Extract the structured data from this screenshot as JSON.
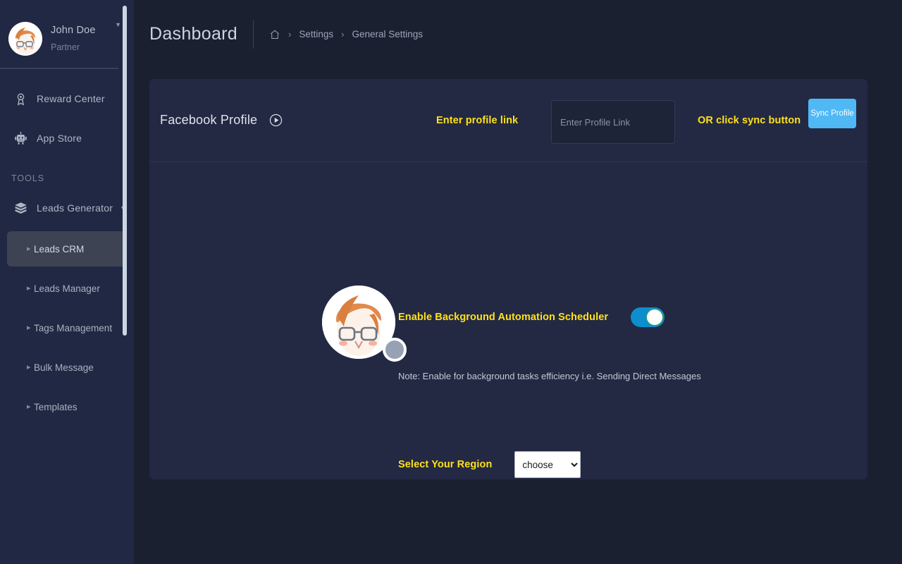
{
  "sidebar": {
    "user": {
      "name": "John Doe",
      "role": "Partner",
      "caret": "chevron-down-icon",
      "avatar_alt": "user-avatar"
    },
    "nav_items": [
      {
        "label": "Reward Center",
        "icon": "award-medal-icon"
      },
      {
        "label": "App Store",
        "icon": "robot-icon"
      }
    ],
    "section_label": "TOOLS",
    "group": {
      "label": "Leads Generator",
      "icon": "layers-stack-icon",
      "caret": "chevron-down-icon"
    },
    "submenu": [
      {
        "label": "Leads CRM",
        "active": true
      },
      {
        "label": "Leads Manager",
        "active": false
      },
      {
        "label": "Tags Management",
        "active": false
      },
      {
        "label": "Bulk Message",
        "active": false
      },
      {
        "label": "Templates",
        "active": false
      }
    ]
  },
  "header": {
    "title": "Dashboard",
    "breadcrumb": {
      "home_icon": "home-icon",
      "items": [
        "Settings",
        "General Settings"
      ],
      "separator": "›"
    }
  },
  "card": {
    "title": "Facebook Profile",
    "title_icon": "play-circle-icon",
    "enter_link_label": "Enter profile link",
    "or_sync_label": "OR click sync button",
    "profile_input": {
      "value": "",
      "placeholder": "Enter Profile Link"
    },
    "sync_button_label": "Sync Profile",
    "scheduler": {
      "label": "Enable Background Automation Scheduler",
      "enabled": true,
      "note": "Note: Enable for background tasks efficiency i.e. Sending Direct Messages"
    },
    "region": {
      "label": "Select Your Region",
      "selected": "choose",
      "options": [
        "choose"
      ]
    },
    "avatar_status": "status-badge"
  },
  "colors": {
    "page_bg": "#1b2031",
    "sidebar_bg": "#212843",
    "card_bg": "#232943",
    "accent_yellow": "#ffe11a",
    "sync_blue": "#4fb8f5",
    "toggle_blue": "#0d8ecf",
    "toggle_knob_border": "#2fa84f",
    "active_item_bg": "#3e4354"
  }
}
